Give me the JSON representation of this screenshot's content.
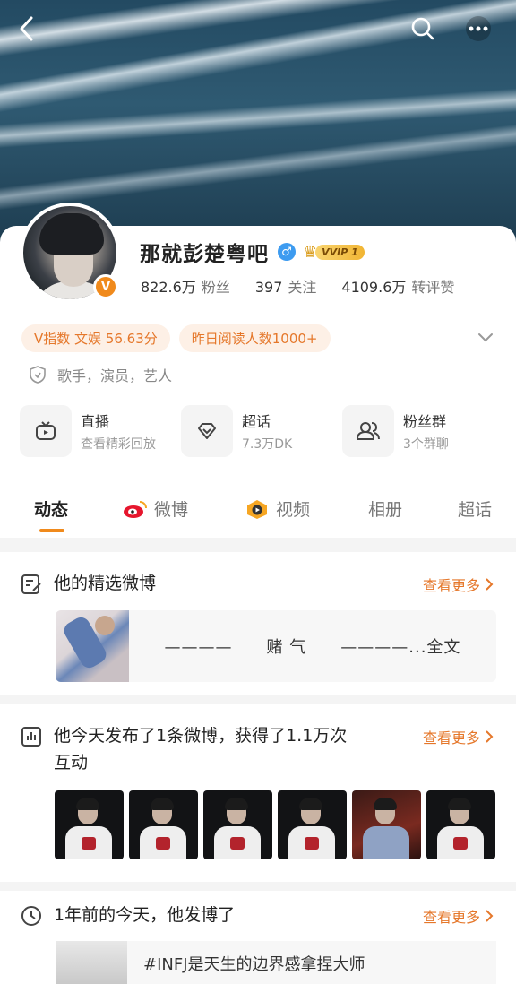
{
  "topbar": {
    "back_icon": "chevron-left-icon",
    "search_icon": "search-icon",
    "more_icon": "more-dots-icon"
  },
  "profile": {
    "name": "那就彭楚粤吧",
    "gender_symbol": "♂",
    "vip_label": "VVIP 1",
    "verified_badge": "V",
    "stats": [
      {
        "num": "822.6万",
        "label": "粉丝"
      },
      {
        "num": "397",
        "label": "关注"
      },
      {
        "num": "4109.6万",
        "label": "转评赞"
      }
    ],
    "pills": [
      "V指数 文娱 56.63分",
      "昨日阅读人数1000+"
    ],
    "description": "歌手，演员，艺人",
    "accent_color": "#f08a1c"
  },
  "entries": [
    {
      "title": "直播",
      "sub": "查看精彩回放",
      "icon": "tv-icon"
    },
    {
      "title": "超话",
      "sub": "7.3万DK",
      "icon": "diamond-icon"
    },
    {
      "title": "粉丝群",
      "sub": "3个群聊",
      "icon": "group-icon"
    }
  ],
  "tabs": [
    "动态",
    "微博",
    "视频",
    "相册",
    "超话"
  ],
  "featured": {
    "title": "他的精选微博",
    "see_more": "查看更多",
    "snippet": "————　　赌 气　　————...全文"
  },
  "today": {
    "title_line1": "他今天发布了1条微博，获得了1.1万次",
    "title_line2": "互动",
    "see_more": "查看更多"
  },
  "memory": {
    "title": "1年前的今天，他发博了",
    "see_more": "查看更多",
    "text": "#INFJ是天生的边界感拿捏大师"
  }
}
